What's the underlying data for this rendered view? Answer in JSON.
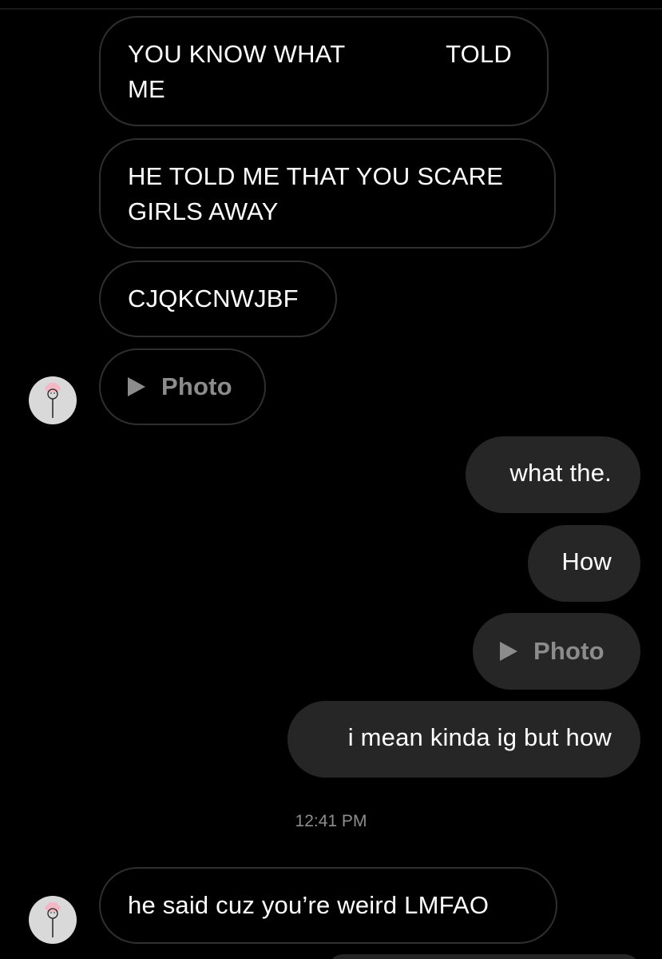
{
  "messages": [
    {
      "id": "m1",
      "sender": "them",
      "line1_a": "YOU KNOW WHAT",
      "line1_b": "TOLD",
      "line2": "ME"
    },
    {
      "id": "m2",
      "sender": "them",
      "line1": "HE TOLD ME THAT YOU SCARE",
      "line2": "GIRLS AWAY"
    },
    {
      "id": "m3",
      "sender": "them",
      "text": "CJQKCNWJBF"
    },
    {
      "id": "m4",
      "sender": "them",
      "type": "photo",
      "label": "Photo"
    },
    {
      "id": "m5",
      "sender": "me",
      "text": "what the."
    },
    {
      "id": "m6",
      "sender": "me",
      "text": "How"
    },
    {
      "id": "m7",
      "sender": "me",
      "type": "photo",
      "label": "Photo"
    },
    {
      "id": "m8",
      "sender": "me",
      "text": "i mean kinda ig but how"
    },
    {
      "id": "m9",
      "sender": "them",
      "text": "he said cuz you’re weird LMFAO"
    }
  ],
  "timestamp": "12:41 PM",
  "icons": {
    "avatar": "avatar-icon",
    "play": "play-icon"
  },
  "colors": {
    "background": "#000000",
    "outgoing_bubble": "#262626",
    "incoming_border": "#2f2f2f",
    "photo_label": "#8c8c8c",
    "timestamp": "#8e8e8e"
  }
}
